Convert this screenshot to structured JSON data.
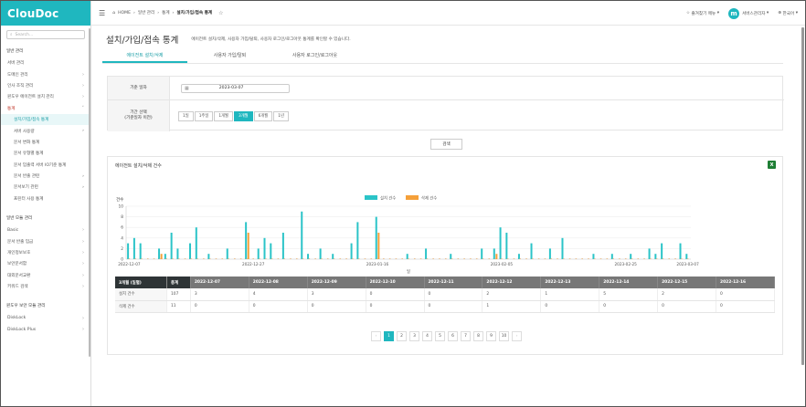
{
  "app": {
    "logo": "ClouDoc"
  },
  "sidebar": {
    "search_placeholder": "Search...",
    "sections": [
      {
        "title": "일반 관리",
        "items": [
          {
            "label": "서버 관리",
            "chev": false
          },
          {
            "label": "도메인 관리",
            "chev": true
          },
          {
            "label": "인사 조직 관리",
            "chev": true
          },
          {
            "label": "윈도우 에이전트 설치 관리",
            "chev": true
          },
          {
            "label": "통계",
            "chev": true,
            "open": true
          }
        ]
      }
    ],
    "stats_sub": [
      {
        "label": "설치/가입/접속 통계",
        "active": true
      },
      {
        "label": "서버 사용량",
        "chev": true
      },
      {
        "label": "문서 변화 통계"
      },
      {
        "label": "문서 유형별 통계"
      },
      {
        "label": "문서 입출력 서버 IO기준 통계"
      },
      {
        "label": "문서 반출 관련",
        "chev": true
      },
      {
        "label": "문서보기 관련",
        "chev": true
      },
      {
        "label": "프린터 사용 통계"
      }
    ],
    "section2": {
      "title": "일반 모듈 관리",
      "items": [
        {
          "label": "Basic",
          "chev": true
        },
        {
          "label": "문서 반출 입금",
          "chev": true
        },
        {
          "label": "개인정보보호",
          "chev": true
        },
        {
          "label": "보안문서함",
          "chev": true
        },
        {
          "label": "대외문서교환",
          "chev": true
        },
        {
          "label": "키워드 검색",
          "chev": true
        }
      ]
    },
    "section3": {
      "title": "윈도우 보안 모듈 관리",
      "items": [
        {
          "label": "DiskLock",
          "chev": true
        },
        {
          "label": "DiskLock Plus",
          "chev": true
        }
      ]
    }
  },
  "topbar": {
    "home": "HOME",
    "crumbs": [
      "일반 관리",
      "통계",
      "설치/가입/접속 통계"
    ],
    "favorites": "즐겨찾기 메뉴",
    "user": "서버스관리자",
    "lang": "한국어",
    "avatar_letter": "m"
  },
  "page": {
    "title": "설치/가입/접속 통계",
    "desc": "에이전트 설치/삭제, 사용자 가입/탈퇴, 사용자 로그인/로그아웃 통계를 확인할 수 있습니다.",
    "tabs": [
      "에이전트 설치/삭제",
      "사용자 가입/탈퇴",
      "사용자 로그인/로그아웃"
    ]
  },
  "filter": {
    "date_label": "기준 일자",
    "date_value": "2023-03-07",
    "period_label_1": "기간 선택",
    "period_label_2": "(기준일자 이전)",
    "periods": [
      "1일",
      "1주일",
      "1개월",
      "3개월",
      "6개월",
      "1년"
    ],
    "active_period": 3,
    "search_button": "검색"
  },
  "chart_data": {
    "type": "bar",
    "title": "에이전트 설치/삭제 건수",
    "ylabel": "건수",
    "xlabel": "일",
    "ylim": [
      0,
      10
    ],
    "yticks": [
      0,
      2,
      4,
      6,
      8,
      10
    ],
    "xtick_labels": [
      "2022-12-07",
      "2022-12-27",
      "2023-01-16",
      "2023-02-05",
      "2023-02-25",
      "2023-03-07"
    ],
    "xtick_index": [
      0,
      20,
      40,
      60,
      80,
      90
    ],
    "legend": [
      "설치 건수",
      "삭제 건수"
    ],
    "colors": [
      "#2bc4c8",
      "#f5a03a"
    ],
    "install": [
      3,
      4,
      3,
      0,
      0,
      2,
      1,
      5,
      2,
      0,
      3,
      6,
      0,
      1,
      0,
      0,
      2,
      0,
      0,
      7,
      0,
      2,
      4,
      3,
      0,
      5,
      0,
      0,
      9,
      1,
      0,
      2,
      0,
      1,
      0,
      0,
      3,
      7,
      0,
      0,
      8,
      0,
      0,
      0,
      0,
      1,
      0,
      0,
      2,
      0,
      0,
      0,
      1,
      0,
      0,
      0,
      0,
      2,
      0,
      2,
      6,
      5,
      0,
      1,
      0,
      3,
      0,
      0,
      2,
      0,
      4,
      0,
      0,
      0,
      0,
      1,
      0,
      0,
      1,
      0,
      0,
      1,
      0,
      0,
      2,
      1,
      3,
      0,
      0,
      3,
      1
    ],
    "delete": [
      0,
      0,
      0,
      0,
      0,
      1,
      0,
      0,
      0,
      0,
      0,
      0,
      0,
      0,
      0,
      0,
      0,
      0,
      0,
      5,
      0,
      0,
      0,
      0,
      0,
      0,
      0,
      0,
      0,
      0,
      0,
      0,
      0,
      0,
      0,
      0,
      0,
      0,
      0,
      0,
      5,
      0,
      0,
      0,
      0,
      0,
      0,
      0,
      0,
      0,
      0,
      0,
      0,
      0,
      0,
      0,
      0,
      0,
      0,
      1,
      0,
      0,
      0,
      0,
      0,
      0,
      0,
      0,
      0,
      0,
      0,
      0,
      0,
      0,
      0,
      0,
      0,
      0,
      0,
      0,
      0,
      0,
      0,
      0,
      0,
      0,
      0,
      0,
      0,
      0,
      0
    ]
  },
  "table": {
    "head_first": "3개월 (일별)",
    "head_total": "총계",
    "dates": [
      "2022-12-07",
      "2022-12-08",
      "2022-12-09",
      "2022-12-10",
      "2022-12-11",
      "2022-12-12",
      "2022-12-13",
      "2022-12-14",
      "2022-12-15",
      "2022-12-16"
    ],
    "rows": [
      {
        "label": "설치 건수",
        "total": "107",
        "values": [
          "3",
          "4",
          "3",
          "0",
          "0",
          "2",
          "1",
          "5",
          "2",
          "0"
        ]
      },
      {
        "label": "삭제 건수",
        "total": "11",
        "values": [
          "0",
          "0",
          "0",
          "0",
          "0",
          "1",
          "0",
          "0",
          "0",
          "0"
        ]
      }
    ]
  },
  "pager": {
    "prev": "‹",
    "next": "›",
    "pages": [
      "1",
      "2",
      "3",
      "4",
      "5",
      "6",
      "7",
      "8",
      "9",
      "10"
    ],
    "active": 0
  },
  "icons": {
    "excel": "X"
  }
}
